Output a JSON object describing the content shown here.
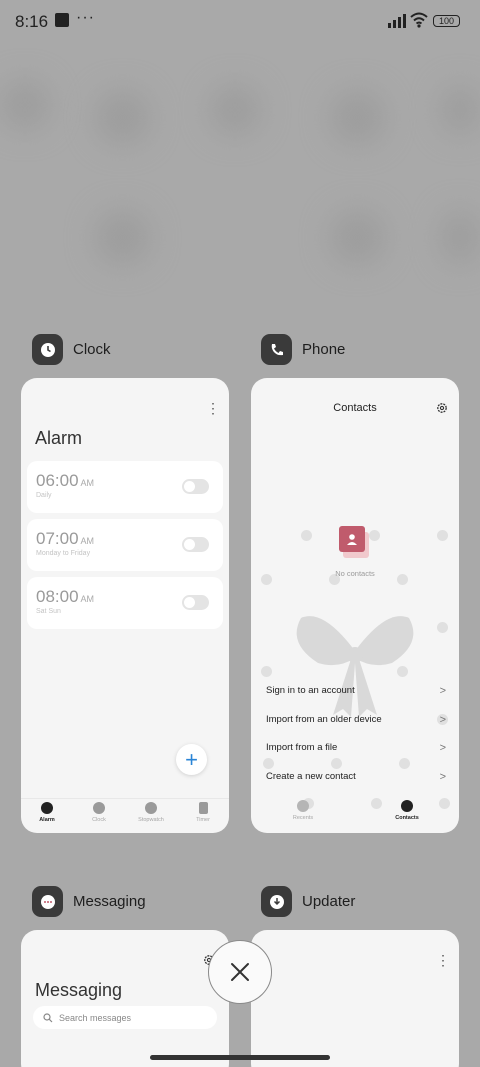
{
  "status_bar": {
    "time": "8:16",
    "more": "···",
    "battery": "100"
  },
  "apps": [
    {
      "name": "Clock",
      "icon": "clock-icon",
      "screen": {
        "title": "Alarm",
        "alarms": [
          {
            "time": "06:00",
            "ampm": "AM",
            "repeat": "Daily"
          },
          {
            "time": "07:00",
            "ampm": "AM",
            "repeat": "Monday to Friday"
          },
          {
            "time": "08:00",
            "ampm": "AM",
            "repeat": "Sat Sun"
          }
        ],
        "add": "+",
        "nav": [
          "Alarm",
          "Clock",
          "Stopwatch",
          "Timer"
        ]
      }
    },
    {
      "name": "Phone",
      "icon": "phone-icon",
      "screen": {
        "title": "Contacts",
        "empty": "No contacts",
        "actions": [
          "Sign in to an account",
          "Import from an older device",
          "Import from a file",
          "Create a new contact"
        ],
        "chevron": ">",
        "nav": [
          "Recents",
          "Contacts"
        ]
      }
    },
    {
      "name": "Messaging",
      "icon": "messaging-icon",
      "screen": {
        "title": "Messaging",
        "search_placeholder": "Search messages"
      }
    },
    {
      "name": "Updater",
      "icon": "updater-icon"
    }
  ],
  "colors": {
    "background": "#a9a9a9",
    "accent_blue": "#2a84d6",
    "contact_pink": "#c05b6c"
  }
}
